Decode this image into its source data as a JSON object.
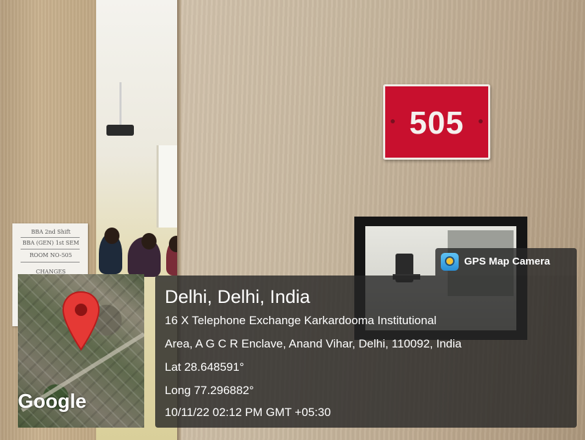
{
  "scene": {
    "room_sign_number": "505",
    "notice_lines": [
      "BBA 2nd Shift",
      "BBA (GEN) 1st SEM",
      "ROOM NO-505",
      "CHANGES"
    ]
  },
  "gps_overlay": {
    "app_name": "GPS Map Camera",
    "app_icon": "gps-map-camera-icon",
    "location_title": "Delhi, Delhi, India",
    "address_line_1": "16 X Telephone Exchange Karkardooma Institutional",
    "address_line_2": "Area, A G C R Enclave, Anand Vihar, Delhi, 110092, India",
    "latitude": "Lat 28.648591°",
    "longitude": "Long 77.296882°",
    "timestamp": "10/11/22 02:12 PM GMT +05:30",
    "map_brand": "Google",
    "pin_color": "#e53935"
  }
}
